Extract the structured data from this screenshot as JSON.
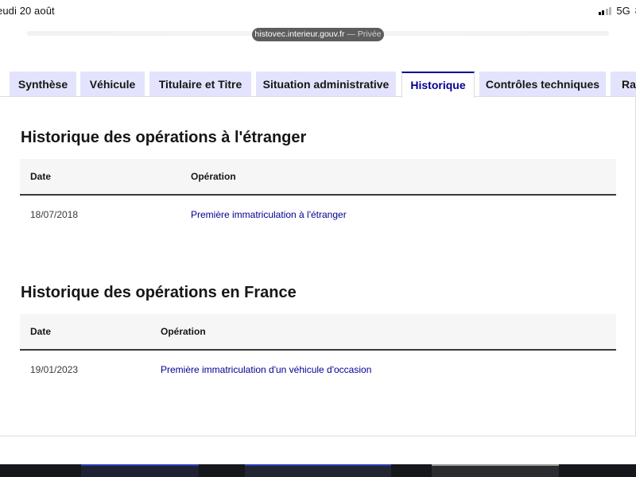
{
  "status": {
    "time": "eudi 20 août",
    "network": "5G",
    "battery": "8"
  },
  "browser": {
    "domain": "histovec.interieur.gouv.fr",
    "private_label": "— Privée"
  },
  "tabs": [
    {
      "label": "Synthèse",
      "active": false
    },
    {
      "label": "Véhicule",
      "active": false
    },
    {
      "label": "Titulaire et Titre",
      "active": false
    },
    {
      "label": "Situation administrative",
      "active": false
    },
    {
      "label": "Historique",
      "active": true
    },
    {
      "label": "Contrôles techniques",
      "active": false
    },
    {
      "label": "Rap",
      "active": false
    }
  ],
  "sections": {
    "abroad": {
      "title": "Historique des opérations à l'étranger",
      "columns": {
        "date": "Date",
        "operation": "Opération"
      },
      "rows": [
        {
          "date": "18/07/2018",
          "operation": "Première immatriculation à l'étranger"
        }
      ]
    },
    "france": {
      "title": "Historique des opérations en France",
      "columns": {
        "date": "Date",
        "operation": "Opération"
      },
      "rows": [
        {
          "date": "19/01/2023",
          "operation": "Première immatriculation d'un véhicule d'occasion"
        }
      ]
    }
  },
  "colors": {
    "accent": "#000091",
    "tab_bg": "#e3e3fd",
    "table_header_bg": "#f6f6f6"
  }
}
